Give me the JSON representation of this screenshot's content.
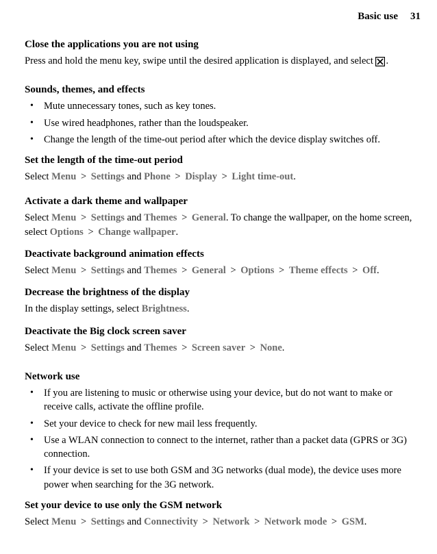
{
  "header": {
    "title": "Basic use",
    "page": "31"
  },
  "close_apps": {
    "title": "Close the applications you are not using",
    "text_before": "Press and hold the menu key, swipe until the desired application is displayed, and select ",
    "text_after": "."
  },
  "sounds": {
    "title": "Sounds, themes, and effects",
    "bullets": [
      "Mute unnecessary tones, such as key tones.",
      "Use wired headphones, rather than the loudspeaker.",
      "Change the length of the time-out period after which the device display switches off."
    ]
  },
  "timeout": {
    "title": "Set the length of the time-out period",
    "select": "Select ",
    "menu": "Menu",
    "settings": "Settings",
    "and": " and ",
    "phone": "Phone",
    "display": "Display",
    "light": "Light time-out",
    "period": "."
  },
  "darktheme": {
    "title": "Activate a dark theme and wallpaper",
    "select": "Select ",
    "menu": "Menu",
    "settings": "Settings",
    "and": " and ",
    "themes": "Themes",
    "general": "General",
    "text_mid": ". To change the wallpaper, on the home screen, select ",
    "options": "Options",
    "change": "Change wallpaper",
    "period": "."
  },
  "animation": {
    "title": "Deactivate background animation effects",
    "select": "Select ",
    "menu": "Menu",
    "settings": "Settings",
    "and": " and ",
    "themes": "Themes",
    "general": "General",
    "options": "Options",
    "theme_effects": "Theme effects",
    "off": "Off",
    "period": "."
  },
  "brightness": {
    "title": "Decrease the brightness of the display",
    "text": "In the display settings, select ",
    "label": "Brightness",
    "period": "."
  },
  "bigclock": {
    "title": "Deactivate the Big clock screen saver",
    "select": "Select ",
    "menu": "Menu",
    "settings": "Settings",
    "and": " and ",
    "themes": "Themes",
    "screensaver": "Screen saver",
    "none": "None",
    "period": "."
  },
  "network": {
    "title": "Network use",
    "bullets": [
      "If you are listening to music or otherwise using your device, but do not want to make or receive calls, activate the offline profile.",
      "Set your device to check for new mail less frequently.",
      "Use a WLAN connection to connect to the internet, rather than a packet data (GPRS or 3G) connection.",
      "If your device is set to use both GSM and 3G networks (dual mode), the device uses more power when searching for the 3G network."
    ]
  },
  "gsm": {
    "title": "Set your device to use only the GSM network",
    "select": "Select ",
    "menu": "Menu",
    "settings": "Settings",
    "and": " and ",
    "connectivity": "Connectivity",
    "network_label": "Network",
    "network_mode": "Network mode",
    "gsm_label": "GSM",
    "period": "."
  }
}
